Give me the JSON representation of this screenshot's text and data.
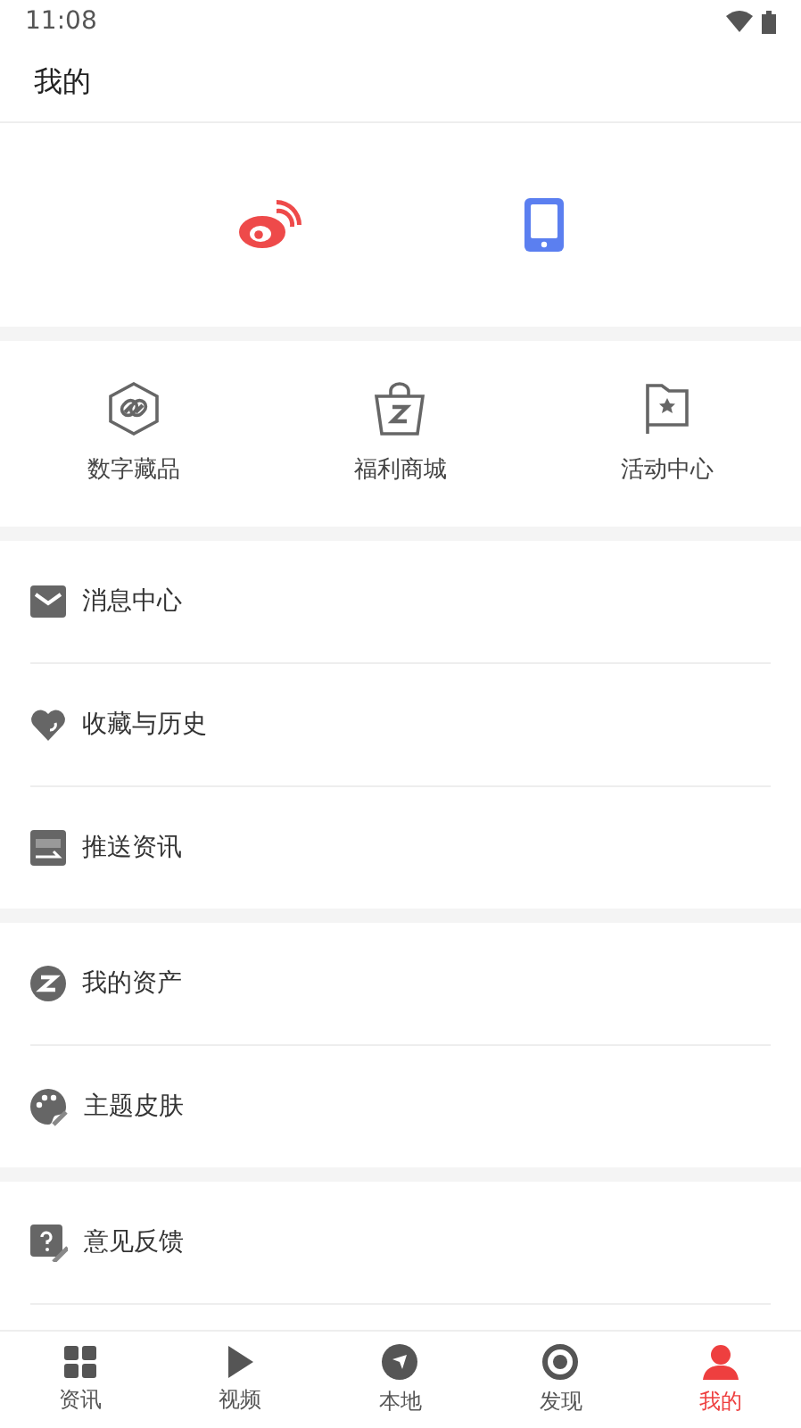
{
  "status_bar": {
    "time": "11:08"
  },
  "header": {
    "title": "我的"
  },
  "login_options": [
    {
      "kind": "weibo"
    },
    {
      "kind": "phone"
    }
  ],
  "features": [
    {
      "kind": "hexagon",
      "label": "数字藏品"
    },
    {
      "kind": "bag",
      "label": "福利商城"
    },
    {
      "kind": "flag",
      "label": "活动中心"
    }
  ],
  "menu_groups": [
    [
      {
        "kind": "mail",
        "label": "消息中心"
      },
      {
        "kind": "heart",
        "label": "收藏与历史"
      },
      {
        "kind": "push",
        "label": "推送资讯"
      }
    ],
    [
      {
        "kind": "coin",
        "label": "我的资产"
      },
      {
        "kind": "palette",
        "label": "主题皮肤"
      }
    ],
    [
      {
        "kind": "feedback",
        "label": "意见反馈"
      }
    ]
  ],
  "tabs": [
    {
      "kind": "grid",
      "label": "资讯",
      "selected": false
    },
    {
      "kind": "play",
      "label": "视频",
      "selected": false
    },
    {
      "kind": "compass",
      "label": "本地",
      "selected": false
    },
    {
      "kind": "target",
      "label": "发现",
      "selected": false
    },
    {
      "kind": "person",
      "label": "我的",
      "selected": true
    }
  ]
}
